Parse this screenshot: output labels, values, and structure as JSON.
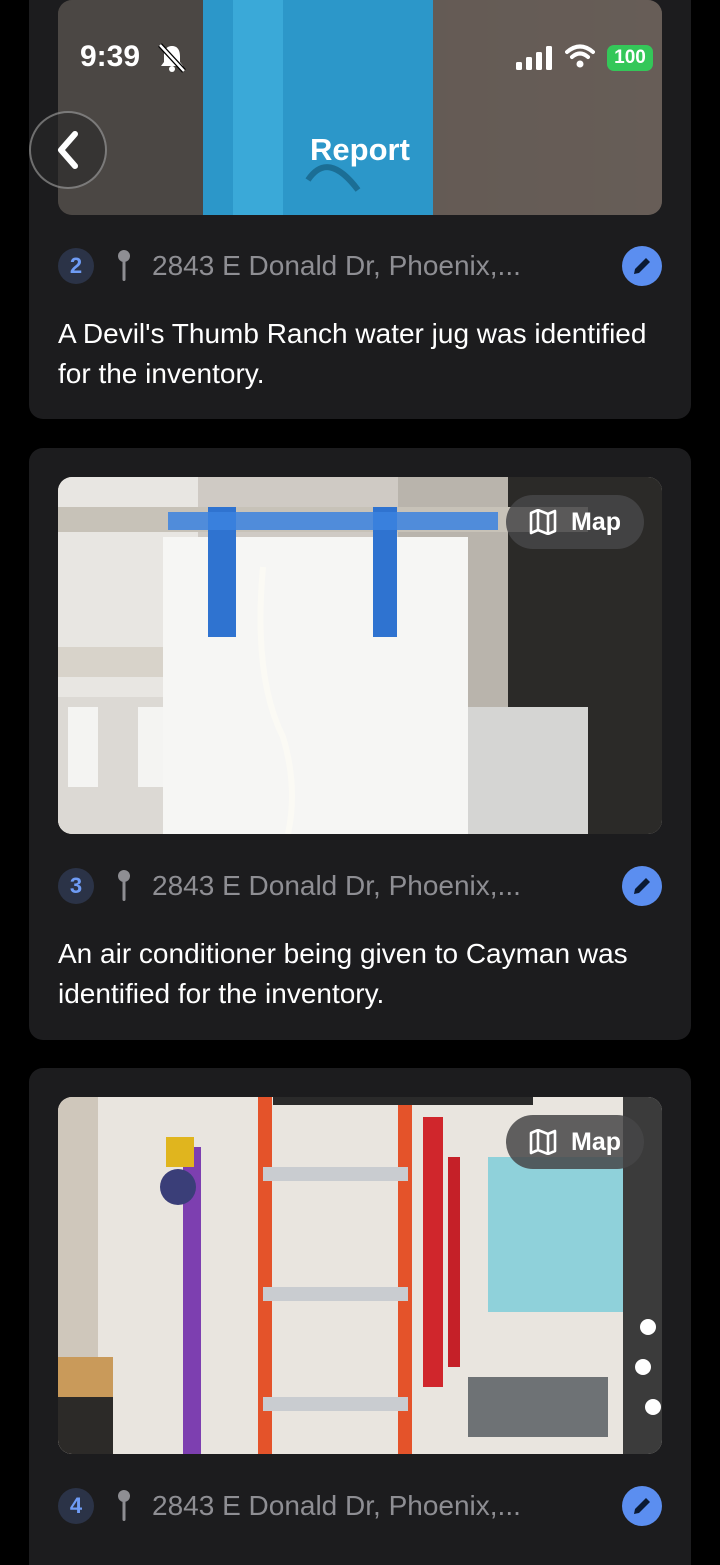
{
  "status_bar": {
    "time": "9:39",
    "battery": "100",
    "icons": [
      "bell-slash-icon",
      "signal-icon",
      "wifi-icon",
      "battery-icon"
    ]
  },
  "header": {
    "title": "Report",
    "back_icon": "chevron-left-icon"
  },
  "items": [
    {
      "number": "2",
      "address": "2843 E Donald Dr, Phoenix,...",
      "description": "A Devil's Thumb Ranch water jug was identified for the inventory."
    },
    {
      "number": "3",
      "address": "2843 E Donald Dr, Phoenix,...",
      "description": "An air conditioner being given to Cayman was identified for the inventory.",
      "map_label": "Map"
    },
    {
      "number": "4",
      "address": "2843 E Donald Dr, Phoenix,...",
      "map_label": "Map"
    }
  ],
  "colors": {
    "card_bg": "#1c1c1e",
    "accent": "#5b8ef0",
    "badge_bg": "#2b3347",
    "muted_text": "#8e8e93",
    "battery": "#34c759"
  }
}
